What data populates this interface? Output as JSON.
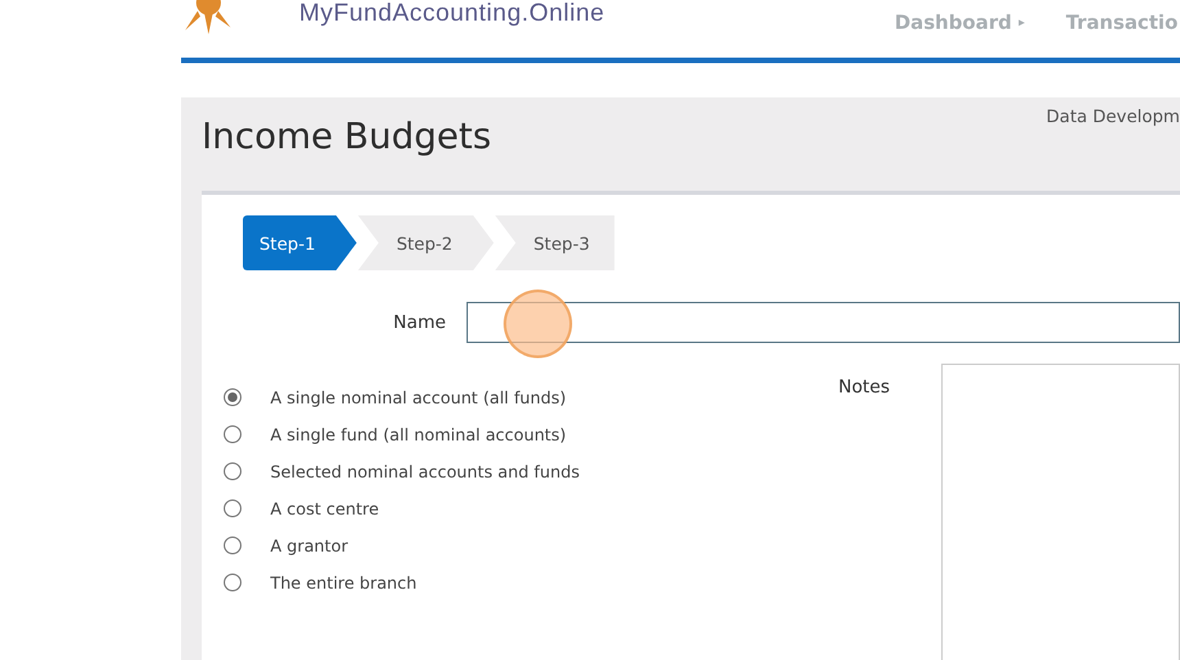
{
  "header": {
    "logo_text": "MyFundAccounting.Online",
    "nav": [
      {
        "label": "Dashboard",
        "caret": "▸"
      },
      {
        "label": "Transactio"
      }
    ]
  },
  "page": {
    "title": "Income Budgets",
    "context": "Data Developm"
  },
  "steps": [
    {
      "label": "Step-1",
      "selected": true
    },
    {
      "label": "Step-2",
      "selected": false
    },
    {
      "label": "Step-3",
      "selected": false
    }
  ],
  "name_field": {
    "label": "Name"
  },
  "scope_options": [
    {
      "label": "A single nominal account (all funds)",
      "selected": true
    },
    {
      "label": "A single fund (all nominal accounts)",
      "selected": false
    },
    {
      "label": "Selected nominal accounts and funds",
      "selected": false
    },
    {
      "label": "A cost centre",
      "selected": false
    },
    {
      "label": "A grantor",
      "selected": false
    },
    {
      "label": "The entire branch",
      "selected": false
    }
  ],
  "notes_field": {
    "label": "Notes"
  }
}
